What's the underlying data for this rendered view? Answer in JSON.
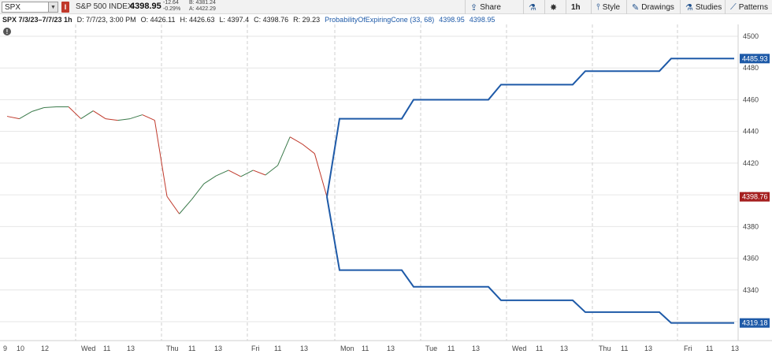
{
  "toolbar": {
    "symbol_input": "SPX",
    "symbol_description": "S&P 500 INDEX",
    "last_price": "4398.95",
    "net_change": "-12.64",
    "percent_change": "-0.29%",
    "bid": "B: 4381.24",
    "ask": "A: 4422.29",
    "exchange_badge": "I",
    "share_label": "Share",
    "interval_label": "1h",
    "style_label": "Style",
    "drawings_label": "Drawings",
    "studies_label": "Studies",
    "patterns_label": "Patterns",
    "icons": {
      "share": "share-icon",
      "flask": "flask-icon",
      "settings": "gear-icon",
      "style": "candle-icon",
      "drawings": "pencil-icon",
      "studies": "flask-icon",
      "patterns": "patterns-icon",
      "dropdown": "chevron-down-icon",
      "alert": "alert-icon"
    }
  },
  "infobar": {
    "title": "SPX 7/3/23–7/7/23 1h",
    "date": "D: 7/7/23, 3:00 PM",
    "open": "O: 4426.11",
    "high": "H: 4426.63",
    "low": "L: 4397.4",
    "close": "C: 4398.76",
    "range": "R: 29.23",
    "study_name": "ProbabilityOfExpiringCone (33, 68)",
    "study_upper": "4398.95",
    "study_lower": "4398.95"
  },
  "colors": {
    "up": "#3a7a4a",
    "down": "#c0392b",
    "cone": "#1e5aa8",
    "grid": "#e6e6e6",
    "price_tag": "#a51f1f"
  },
  "chart_data": {
    "type": "line",
    "ylim": [
      4300,
      4505
    ],
    "y_ticks": [
      4500,
      4480,
      4460,
      4440,
      4420,
      4400,
      4380,
      4360,
      4340,
      4320
    ],
    "x_labels": [
      "9",
      "10",
      "12",
      "Wed",
      "11",
      "13",
      "Thu",
      "11",
      "13",
      "Fri",
      "11",
      "13",
      "Mon",
      "11",
      "13",
      "Tue",
      "11",
      "13",
      "Wed",
      "11",
      "13",
      "Thu",
      "11",
      "13",
      "Fri",
      "11",
      "13"
    ],
    "day_labels": [
      "Wed",
      "Thu",
      "Fri",
      "Mon",
      "Tue",
      "Wed",
      "Thu",
      "Fri"
    ],
    "price_series": {
      "name": "SPX",
      "values": [
        4449.5,
        4448,
        4452.5,
        4455,
        4455.5,
        4455.5,
        4448,
        4453,
        4448,
        4447,
        4448,
        4450.5,
        4447,
        4399,
        4388,
        4397,
        4407,
        4412,
        4415.5,
        4411.5,
        4415.5,
        4412.5,
        4418.5,
        4436.5,
        4432,
        4426,
        4398.76
      ]
    },
    "cone_upper": {
      "name": "Cone upper",
      "values": [
        4398.76,
        4448,
        4448,
        4448,
        4448,
        4448,
        4448,
        4460,
        4460,
        4460,
        4460,
        4460,
        4460,
        4469.5,
        4469.5,
        4469.5,
        4469.5,
        4469.5,
        4469.5,
        4478,
        4478,
        4478,
        4478,
        4478,
        4478,
        4485.93,
        4485.93,
        4485.93,
        4485.93,
        4485.93,
        4485.93
      ]
    },
    "cone_lower": {
      "name": "Cone lower",
      "values": [
        4398.76,
        4352.5,
        4352.5,
        4352.5,
        4352.5,
        4352.5,
        4352.5,
        4342,
        4342,
        4342,
        4342,
        4342,
        4342,
        4333.5,
        4333.5,
        4333.5,
        4333.5,
        4333.5,
        4333.5,
        4326,
        4326,
        4326,
        4326,
        4326,
        4326,
        4319.18,
        4319.18,
        4319.18,
        4319.18,
        4319.18,
        4319.18
      ]
    },
    "price_tags": {
      "upper": "4485.93",
      "last": "4398.76",
      "lower": "4319.18"
    },
    "grid": true
  }
}
